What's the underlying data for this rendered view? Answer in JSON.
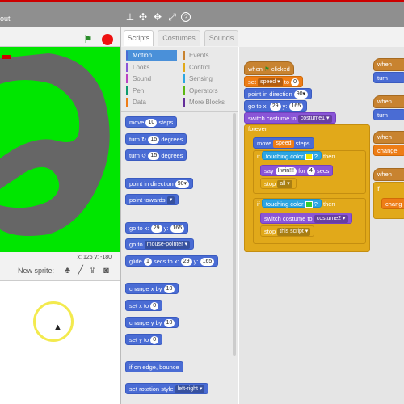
{
  "window": {
    "title": "out"
  },
  "topbar": {
    "icons": [
      "stamp-icon",
      "expand-icon",
      "shrink-icon",
      "zoom-in-icon",
      "help-icon"
    ]
  },
  "stage": {
    "x_label": "x:",
    "x": "126",
    "y_label": "y:",
    "y": "-180"
  },
  "sprites": {
    "new_sprite_label": "New sprite:"
  },
  "tabs": [
    "Scripts",
    "Costumes",
    "Sounds"
  ],
  "categories": {
    "left": [
      "Motion",
      "Looks",
      "Sound",
      "Pen",
      "Data"
    ],
    "right": [
      "Events",
      "Control",
      "Sensing",
      "Operators",
      "More Blocks"
    ],
    "colors": {
      "Motion": "#4a6cd4",
      "Looks": "#8a55d7",
      "Sound": "#bb42c3",
      "Pen": "#0e9a6c",
      "Data": "#ee7d16",
      "Events": "#c88330",
      "Control": "#e1a91a",
      "Sensing": "#2ca5e2",
      "Operators": "#5cb712",
      "More Blocks": "#632d99"
    }
  },
  "palette": {
    "move_pre": "move",
    "move_val": "10",
    "move_post": "steps",
    "turn_r": "turn",
    "turn_r_val": "15",
    "turn_r_post": "degrees",
    "turn_l": "turn",
    "turn_l_val": "15",
    "turn_l_post": "degrees",
    "point_dir": "point in direction",
    "point_dir_val": "90▾",
    "point_towards": "point towards",
    "goto_xy": "go to x:",
    "goto_x": "29",
    "goto_y_label": "y:",
    "goto_y": "165",
    "goto": "go to",
    "goto_val": "mouse-pointer ▾",
    "glide": "glide",
    "glide_val": "1",
    "glide_mid": "secs to x:",
    "glide_x": "29",
    "glide_y_label": "y:",
    "glide_y": "165",
    "change_x": "change x by",
    "change_x_val": "10",
    "set_x": "set x to",
    "set_x_val": "0",
    "change_y": "change y by",
    "change_y_val": "10",
    "set_y": "set y to",
    "set_y_val": "0",
    "edge": "if on edge, bounce",
    "rotation": "set rotation style",
    "rotation_val": "left-right ▾"
  },
  "script": {
    "hat": "when",
    "hat_post": "clicked",
    "set_speed": "set",
    "set_speed_var": "speed ▾",
    "set_speed_to": "to",
    "set_speed_val": "0",
    "point": "point in direction",
    "point_val": "90▾",
    "goto": "go to x:",
    "goto_x": "29",
    "goto_y_label": "y:",
    "goto_y": "165",
    "switch": "switch costume to",
    "switch_val": "costume1 ▾",
    "forever": "forever",
    "move": "move",
    "move_var": "speed",
    "move_post": "steps",
    "if1": "if",
    "touching1": "touching color",
    "then1": "then",
    "say": "say",
    "say_val": "I win!!!",
    "say_for": "for",
    "say_secs": "4",
    "say_post": "secs",
    "stop1": "stop",
    "stop1_val": "all ▾",
    "if2": "if",
    "touching2": "touching color",
    "then2": "then",
    "switch2": "switch costume to",
    "switch2_val": "costume2 ▾",
    "stop2": "stop",
    "stop2_val": "this script ▾"
  },
  "right_scripts": {
    "when_up": "when",
    "turn1": "turn",
    "when_left": "when",
    "turn2": "turn",
    "when_up2": "when",
    "change": "change",
    "when_down": "when",
    "if_label": "if",
    "change2": "chang"
  },
  "colors": {
    "chip_yellow": "#f2e600",
    "chip_green": "#33cc33"
  }
}
